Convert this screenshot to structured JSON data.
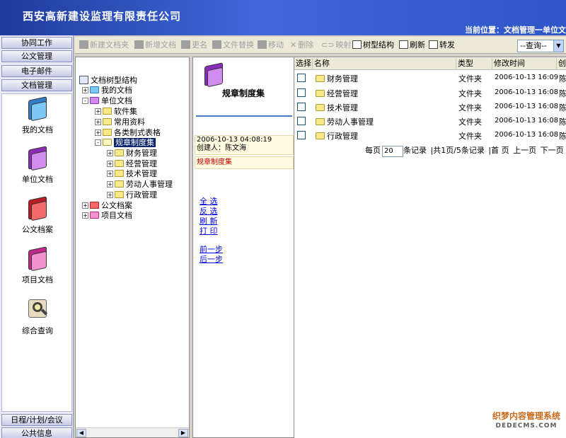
{
  "header": {
    "company": "西安高新建设监理有限责任公司",
    "location": "当前位置：文档管理一单位文"
  },
  "nav": {
    "top_buttons": [
      "协同工作",
      "公文管理",
      "电子邮件",
      "文档管理"
    ],
    "icons": [
      {
        "label": "我的文档",
        "icon": "folder-blue-icon",
        "color": "#4aa3e8"
      },
      {
        "label": "单位文档",
        "icon": "folder-purple-icon",
        "color": "#b04ad8"
      },
      {
        "label": "公文档案",
        "icon": "folder-red-icon",
        "color": "#e8323c"
      },
      {
        "label": "项目文档",
        "icon": "folder-pink-icon",
        "color": "#e84aa6"
      },
      {
        "label": "综合查询",
        "icon": "magnifier-icon",
        "color": "#c8a24a"
      }
    ],
    "bottom_buttons": [
      "日程/计划/会议",
      "公共信息"
    ]
  },
  "toolbar": {
    "new_folder": "新建文档夹",
    "new_doc": "新增文档",
    "rename": "更名",
    "replace": "文件替换",
    "move": "移动",
    "delete": "删除",
    "map": "映射",
    "tree": "树型结构",
    "refresh": "刷新",
    "forward": "转发",
    "query_select": "--查询--"
  },
  "tree": {
    "root": "文档树型结构",
    "items": [
      {
        "label": "我的文档",
        "expander": "+"
      },
      {
        "label": "单位文档",
        "expander": "-"
      },
      {
        "label": "软件集",
        "expander": "+"
      },
      {
        "label": "常用资料",
        "expander": "+"
      },
      {
        "label": "各类制式表格",
        "expander": "+"
      },
      {
        "label": "规章制度集",
        "expander": "-"
      },
      {
        "label": "财务管理",
        "expander": "+"
      },
      {
        "label": "经营管理",
        "expander": "+"
      },
      {
        "label": "技术管理",
        "expander": "+"
      },
      {
        "label": "劳动人事管理",
        "expander": "+"
      },
      {
        "label": "行政管理",
        "expander": "+"
      },
      {
        "label": "公文档案",
        "expander": "+"
      },
      {
        "label": "项目文档",
        "expander": "+"
      }
    ]
  },
  "detail": {
    "title": "规章制度集",
    "date": "2006-10-13 04:08:19",
    "creator": "创建人：陈文海",
    "category": "规章制度集",
    "actions": [
      "全 选",
      "反 选",
      "刷 新",
      "打 印"
    ],
    "steps": [
      "前一步",
      "后一步"
    ]
  },
  "list": {
    "columns": [
      "选择",
      "名称",
      "类型",
      "修改时间",
      "创"
    ],
    "rows": [
      {
        "name": "财务管理",
        "type": "文件夹",
        "time": "2006-10-13 16:09",
        "creator": "陈"
      },
      {
        "name": "经营管理",
        "type": "文件夹",
        "time": "2006-10-13 16:08",
        "creator": "陈"
      },
      {
        "name": "技术管理",
        "type": "文件夹",
        "time": "2006-10-13 16:08",
        "creator": "陈"
      },
      {
        "name": "劳动人事管理",
        "type": "文件夹",
        "time": "2006-10-13 16:08",
        "creator": "陈"
      },
      {
        "name": "行政管理",
        "type": "文件夹",
        "time": "2006-10-13 16:08",
        "creator": "陈"
      }
    ],
    "pager": {
      "per_page_label": "每页",
      "per_page_value": "20",
      "records_label": "条记录",
      "summary": "|共1页/5条记录",
      "first": "|首 页",
      "prev": "上一页",
      "next": "下一页"
    }
  },
  "watermark": {
    "line1": "织梦内容管理系统",
    "line2": "DEDECMS.COM"
  }
}
